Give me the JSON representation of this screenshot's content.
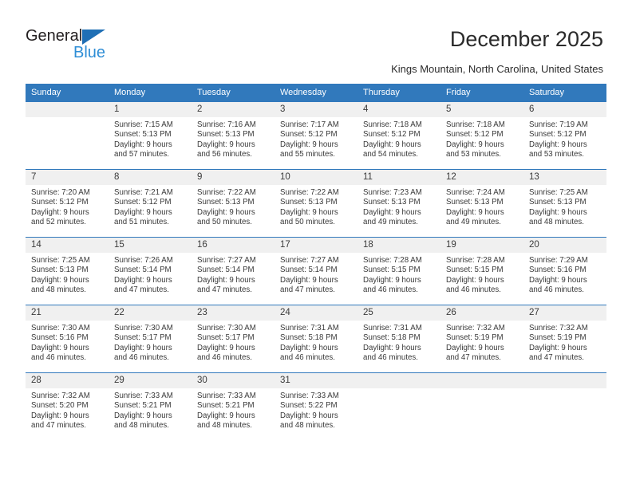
{
  "brand": {
    "name_top": "General",
    "name_bottom": "Blue",
    "accent_color": "#2f8ed6",
    "triangle_color": "#1f6fb5"
  },
  "header": {
    "title": "December 2025",
    "subtitle": "Kings Mountain, North Carolina, United States"
  },
  "calendar": {
    "header_bg": "#3179bc",
    "header_text_color": "#ffffff",
    "daynum_bg": "#f0f0f0",
    "weekdays": [
      "Sunday",
      "Monday",
      "Tuesday",
      "Wednesday",
      "Thursday",
      "Friday",
      "Saturday"
    ],
    "weeks": [
      [
        {
          "day": "",
          "sunrise": "",
          "sunset": "",
          "daylight_line1": "",
          "daylight_line2": ""
        },
        {
          "day": "1",
          "sunrise": "Sunrise: 7:15 AM",
          "sunset": "Sunset: 5:13 PM",
          "daylight_line1": "Daylight: 9 hours",
          "daylight_line2": "and 57 minutes."
        },
        {
          "day": "2",
          "sunrise": "Sunrise: 7:16 AM",
          "sunset": "Sunset: 5:13 PM",
          "daylight_line1": "Daylight: 9 hours",
          "daylight_line2": "and 56 minutes."
        },
        {
          "day": "3",
          "sunrise": "Sunrise: 7:17 AM",
          "sunset": "Sunset: 5:12 PM",
          "daylight_line1": "Daylight: 9 hours",
          "daylight_line2": "and 55 minutes."
        },
        {
          "day": "4",
          "sunrise": "Sunrise: 7:18 AM",
          "sunset": "Sunset: 5:12 PM",
          "daylight_line1": "Daylight: 9 hours",
          "daylight_line2": "and 54 minutes."
        },
        {
          "day": "5",
          "sunrise": "Sunrise: 7:18 AM",
          "sunset": "Sunset: 5:12 PM",
          "daylight_line1": "Daylight: 9 hours",
          "daylight_line2": "and 53 minutes."
        },
        {
          "day": "6",
          "sunrise": "Sunrise: 7:19 AM",
          "sunset": "Sunset: 5:12 PM",
          "daylight_line1": "Daylight: 9 hours",
          "daylight_line2": "and 53 minutes."
        }
      ],
      [
        {
          "day": "7",
          "sunrise": "Sunrise: 7:20 AM",
          "sunset": "Sunset: 5:12 PM",
          "daylight_line1": "Daylight: 9 hours",
          "daylight_line2": "and 52 minutes."
        },
        {
          "day": "8",
          "sunrise": "Sunrise: 7:21 AM",
          "sunset": "Sunset: 5:12 PM",
          "daylight_line1": "Daylight: 9 hours",
          "daylight_line2": "and 51 minutes."
        },
        {
          "day": "9",
          "sunrise": "Sunrise: 7:22 AM",
          "sunset": "Sunset: 5:13 PM",
          "daylight_line1": "Daylight: 9 hours",
          "daylight_line2": "and 50 minutes."
        },
        {
          "day": "10",
          "sunrise": "Sunrise: 7:22 AM",
          "sunset": "Sunset: 5:13 PM",
          "daylight_line1": "Daylight: 9 hours",
          "daylight_line2": "and 50 minutes."
        },
        {
          "day": "11",
          "sunrise": "Sunrise: 7:23 AM",
          "sunset": "Sunset: 5:13 PM",
          "daylight_line1": "Daylight: 9 hours",
          "daylight_line2": "and 49 minutes."
        },
        {
          "day": "12",
          "sunrise": "Sunrise: 7:24 AM",
          "sunset": "Sunset: 5:13 PM",
          "daylight_line1": "Daylight: 9 hours",
          "daylight_line2": "and 49 minutes."
        },
        {
          "day": "13",
          "sunrise": "Sunrise: 7:25 AM",
          "sunset": "Sunset: 5:13 PM",
          "daylight_line1": "Daylight: 9 hours",
          "daylight_line2": "and 48 minutes."
        }
      ],
      [
        {
          "day": "14",
          "sunrise": "Sunrise: 7:25 AM",
          "sunset": "Sunset: 5:13 PM",
          "daylight_line1": "Daylight: 9 hours",
          "daylight_line2": "and 48 minutes."
        },
        {
          "day": "15",
          "sunrise": "Sunrise: 7:26 AM",
          "sunset": "Sunset: 5:14 PM",
          "daylight_line1": "Daylight: 9 hours",
          "daylight_line2": "and 47 minutes."
        },
        {
          "day": "16",
          "sunrise": "Sunrise: 7:27 AM",
          "sunset": "Sunset: 5:14 PM",
          "daylight_line1": "Daylight: 9 hours",
          "daylight_line2": "and 47 minutes."
        },
        {
          "day": "17",
          "sunrise": "Sunrise: 7:27 AM",
          "sunset": "Sunset: 5:14 PM",
          "daylight_line1": "Daylight: 9 hours",
          "daylight_line2": "and 47 minutes."
        },
        {
          "day": "18",
          "sunrise": "Sunrise: 7:28 AM",
          "sunset": "Sunset: 5:15 PM",
          "daylight_line1": "Daylight: 9 hours",
          "daylight_line2": "and 46 minutes."
        },
        {
          "day": "19",
          "sunrise": "Sunrise: 7:28 AM",
          "sunset": "Sunset: 5:15 PM",
          "daylight_line1": "Daylight: 9 hours",
          "daylight_line2": "and 46 minutes."
        },
        {
          "day": "20",
          "sunrise": "Sunrise: 7:29 AM",
          "sunset": "Sunset: 5:16 PM",
          "daylight_line1": "Daylight: 9 hours",
          "daylight_line2": "and 46 minutes."
        }
      ],
      [
        {
          "day": "21",
          "sunrise": "Sunrise: 7:30 AM",
          "sunset": "Sunset: 5:16 PM",
          "daylight_line1": "Daylight: 9 hours",
          "daylight_line2": "and 46 minutes."
        },
        {
          "day": "22",
          "sunrise": "Sunrise: 7:30 AM",
          "sunset": "Sunset: 5:17 PM",
          "daylight_line1": "Daylight: 9 hours",
          "daylight_line2": "and 46 minutes."
        },
        {
          "day": "23",
          "sunrise": "Sunrise: 7:30 AM",
          "sunset": "Sunset: 5:17 PM",
          "daylight_line1": "Daylight: 9 hours",
          "daylight_line2": "and 46 minutes."
        },
        {
          "day": "24",
          "sunrise": "Sunrise: 7:31 AM",
          "sunset": "Sunset: 5:18 PM",
          "daylight_line1": "Daylight: 9 hours",
          "daylight_line2": "and 46 minutes."
        },
        {
          "day": "25",
          "sunrise": "Sunrise: 7:31 AM",
          "sunset": "Sunset: 5:18 PM",
          "daylight_line1": "Daylight: 9 hours",
          "daylight_line2": "and 46 minutes."
        },
        {
          "day": "26",
          "sunrise": "Sunrise: 7:32 AM",
          "sunset": "Sunset: 5:19 PM",
          "daylight_line1": "Daylight: 9 hours",
          "daylight_line2": "and 47 minutes."
        },
        {
          "day": "27",
          "sunrise": "Sunrise: 7:32 AM",
          "sunset": "Sunset: 5:19 PM",
          "daylight_line1": "Daylight: 9 hours",
          "daylight_line2": "and 47 minutes."
        }
      ],
      [
        {
          "day": "28",
          "sunrise": "Sunrise: 7:32 AM",
          "sunset": "Sunset: 5:20 PM",
          "daylight_line1": "Daylight: 9 hours",
          "daylight_line2": "and 47 minutes."
        },
        {
          "day": "29",
          "sunrise": "Sunrise: 7:33 AM",
          "sunset": "Sunset: 5:21 PM",
          "daylight_line1": "Daylight: 9 hours",
          "daylight_line2": "and 48 minutes."
        },
        {
          "day": "30",
          "sunrise": "Sunrise: 7:33 AM",
          "sunset": "Sunset: 5:21 PM",
          "daylight_line1": "Daylight: 9 hours",
          "daylight_line2": "and 48 minutes."
        },
        {
          "day": "31",
          "sunrise": "Sunrise: 7:33 AM",
          "sunset": "Sunset: 5:22 PM",
          "daylight_line1": "Daylight: 9 hours",
          "daylight_line2": "and 48 minutes."
        },
        {
          "day": "",
          "sunrise": "",
          "sunset": "",
          "daylight_line1": "",
          "daylight_line2": ""
        },
        {
          "day": "",
          "sunrise": "",
          "sunset": "",
          "daylight_line1": "",
          "daylight_line2": ""
        },
        {
          "day": "",
          "sunrise": "",
          "sunset": "",
          "daylight_line1": "",
          "daylight_line2": ""
        }
      ]
    ]
  }
}
